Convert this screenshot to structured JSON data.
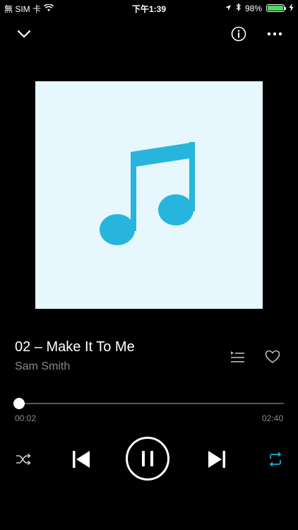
{
  "status_bar": {
    "carrier": "無 SIM 卡",
    "time": "下午1:39",
    "battery_percent": "98%",
    "battery_level": 0.98,
    "battery_color": "#4cd964"
  },
  "nav": {
    "collapse_icon": "chevron-down-icon",
    "info_icon": "info-icon",
    "more_icon": "more-icon"
  },
  "album_art": {
    "background": "#e6f8fd",
    "icon": "music-note-icon",
    "icon_color": "#27b5dd"
  },
  "track": {
    "title": "02 – Make It To Me",
    "artist": "Sam Smith"
  },
  "progress": {
    "elapsed": "00:02",
    "total": "02:40",
    "fraction": 0.0125
  },
  "controls": {
    "shuffle_icon": "shuffle-icon",
    "previous_icon": "skip-previous-icon",
    "pause_icon": "pause-icon",
    "next_icon": "skip-next-icon",
    "repeat_icon": "repeat-icon",
    "repeat_color": "#1fa6d8",
    "queue_icon": "queue-icon",
    "favorite_icon": "heart-icon"
  }
}
